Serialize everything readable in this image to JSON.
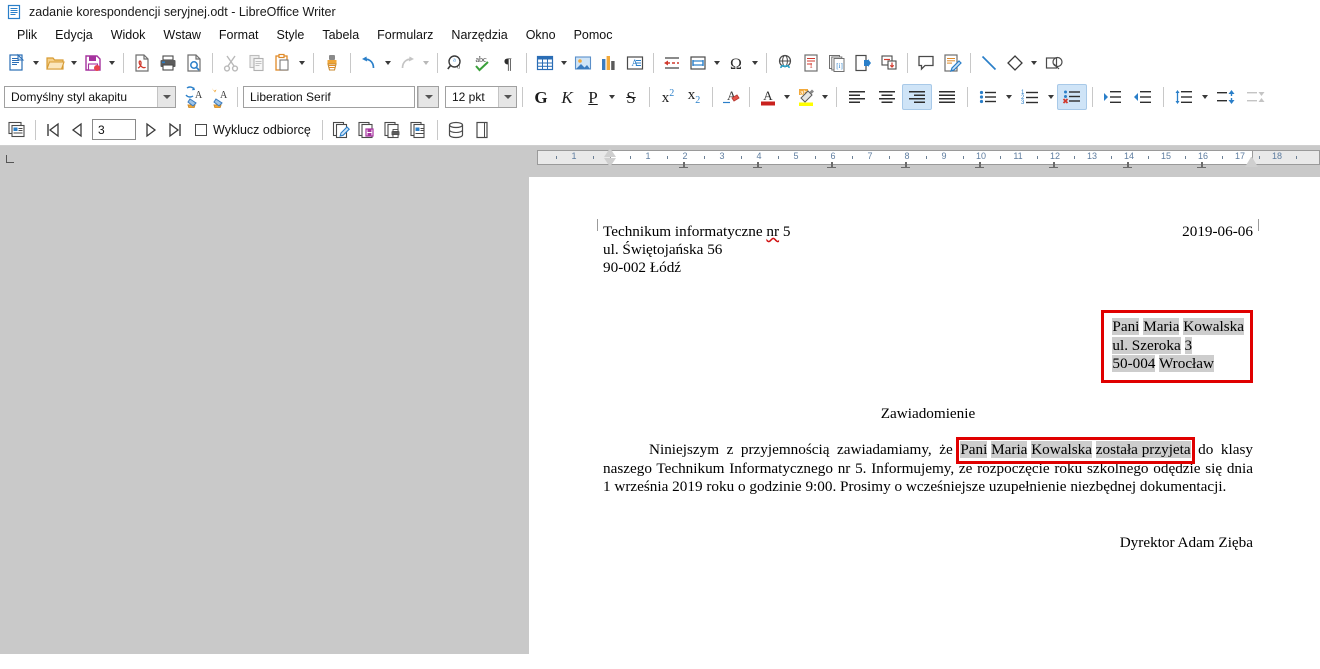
{
  "window": {
    "title": "zadanie korespondencji seryjnej.odt - LibreOffice Writer",
    "app_icon": "writer-document-icon"
  },
  "menubar": {
    "items": [
      {
        "label": "Plik",
        "accel": "P"
      },
      {
        "label": "Edycja",
        "accel": "E"
      },
      {
        "label": "Widok",
        "accel": "W"
      },
      {
        "label": "Wstaw",
        "accel": "s"
      },
      {
        "label": "Format",
        "accel": "o"
      },
      {
        "label": "Style",
        "accel": "y"
      },
      {
        "label": "Tabela",
        "accel": "a"
      },
      {
        "label": "Formularz",
        "accel": "r"
      },
      {
        "label": "Narzędzia",
        "accel": "N"
      },
      {
        "label": "Okno",
        "accel": "O"
      },
      {
        "label": "Pomoc",
        "accel": "o"
      }
    ]
  },
  "toolbar_standard": {
    "buttons": [
      "new-document-icon",
      "open-file-icon",
      "save-icon",
      "export-pdf-icon",
      "print-icon",
      "print-preview-icon",
      "cut-icon",
      "copy-icon",
      "paste-icon",
      "clone-formatting-icon",
      "undo-icon",
      "redo-icon",
      "find-replace-icon",
      "spelling-icon",
      "formatting-marks-icon",
      "insert-table-icon",
      "insert-image-icon",
      "insert-chart-icon",
      "insert-text-box-icon",
      "insert-page-break-icon",
      "insert-field-icon",
      "special-character-icon",
      "insert-hyperlink-icon",
      "insert-footnote-icon",
      "insert-endnote-icon",
      "insert-bookmark-icon",
      "insert-cross-reference-icon",
      "insert-comment-icon",
      "track-changes-icon",
      "insert-line-icon",
      "basic-shapes-icon",
      "show-draw-functions-icon"
    ]
  },
  "toolbar_format": {
    "paragraph_style": "Domyślny styl akapitu",
    "font_name": "Liberation Serif",
    "font_size": "12 pkt",
    "bold_label": "G",
    "italic_label": "K",
    "underline_label": "P",
    "strikethrough_label": "S",
    "superscript_label": "x",
    "superscript_sup": "2",
    "subscript_label": "x",
    "subscript_sub": "2",
    "buttons": [
      "update-style-icon",
      "new-style-icon",
      "clear-formatting-icon",
      "font-color-icon",
      "highlight-color-icon",
      "align-left-icon",
      "align-center-icon",
      "align-right-icon",
      "justified-icon",
      "unordered-list-icon",
      "ordered-list-icon",
      "no-list-icon",
      "increase-indent-icon",
      "decrease-indent-icon",
      "line-spacing-icon",
      "paragraph-spacing-increase-icon",
      "paragraph-spacing-decrease-icon"
    ],
    "active_alignment": "align-right-icon",
    "active_list": "no-list-icon",
    "font_color": "#c9211e",
    "highlight_color": "#ffff00"
  },
  "toolbar_mailmerge": {
    "record_number": "3",
    "exclude_label": "Wyklucz odbiorcę",
    "exclude_checked": false,
    "buttons": [
      "mail-merge-recipients-icon",
      "first-record-icon",
      "previous-record-icon",
      "next-record-icon",
      "last-record-icon",
      "edit-individual-documents-icon",
      "save-merged-documents-icon",
      "print-merged-documents-icon",
      "send-email-messages-icon",
      "data-sources-icon",
      "toggle-sidebar-icon"
    ]
  },
  "ruler": {
    "unit": "cm",
    "numbers": [
      "1",
      "1",
      "2",
      "3",
      "4",
      "5",
      "6",
      "7",
      "8",
      "9",
      "10",
      "11",
      "12",
      "13",
      "14",
      "15",
      "16",
      "17",
      "18"
    ],
    "left_margin_cm": 2.0,
    "right_margin_cm": 17.0
  },
  "document": {
    "sender": {
      "line1_pre": "Technikum informatyczne ",
      "line1_misspelled": "nr",
      "line1_post": " 5",
      "line2": "ul. Świętojańska 56",
      "line3": "90-002 Łódź"
    },
    "date": "2019-06-06",
    "address_block": {
      "annotated": true,
      "annotation_color": "#e00000",
      "line1": [
        {
          "text": "Pani",
          "field": true
        },
        {
          "text": " ",
          "field": false
        },
        {
          "text": "Maria",
          "field": true
        },
        {
          "text": " ",
          "field": false
        },
        {
          "text": "Kowalska",
          "field": true
        }
      ],
      "line2": [
        {
          "text": "ul. Szeroka",
          "field": true
        },
        {
          "text": " ",
          "field": false
        },
        {
          "text": "3",
          "field": true
        }
      ],
      "line3": [
        {
          "text": "50-004",
          "field": true
        },
        {
          "text": " ",
          "field": false
        },
        {
          "text": "Wrocław",
          "field": true
        }
      ]
    },
    "subject": "Zawiadomienie",
    "body": {
      "p1_indent": "",
      "p1_before": "Niniejszym z przyjemnością zawiadamiamy, że ",
      "p1_fields": [
        {
          "text": "Pani",
          "field": true
        },
        {
          "text": " ",
          "field": false
        },
        {
          "text": "Maria",
          "field": true
        },
        {
          "text": " ",
          "field": false
        },
        {
          "text": "Kowalska",
          "field": true
        },
        {
          "text": " ",
          "field": false
        },
        {
          "text": "została przyjeta",
          "field": true
        }
      ],
      "p1_after": " do klasy naszego Technikum Informatycznego nr 5. Informujemy, ze rozpoczęcie roku szkolnego odędzie się dnia 1 września 2019 roku o godzinie 9:00. Prosimy o wcześniejsze uzupełnienie niezbędnej dokumentacji."
    },
    "signature": "Dyrektor Adam Zięba"
  },
  "colors": {
    "field_shading": "#cdcdcd",
    "annotation_red": "#e00000",
    "spellcheck_red": "#d01010",
    "active_toolbar_blue": "#cfe4f7",
    "workspace_gray": "#c9c9c9"
  }
}
